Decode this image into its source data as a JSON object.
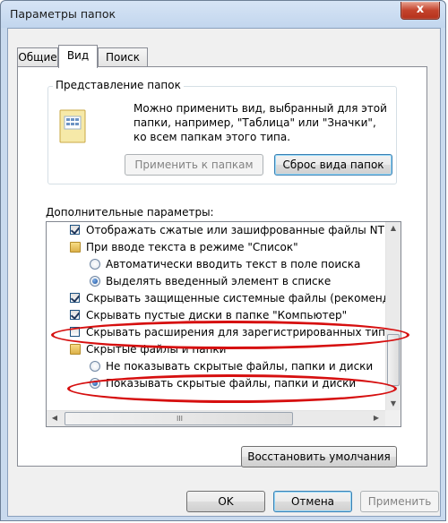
{
  "window": {
    "title": "Параметры папок",
    "close_glyph": "x"
  },
  "tabs": [
    {
      "label": "Общие",
      "active": false
    },
    {
      "label": "Вид",
      "active": true
    },
    {
      "label": "Поиск",
      "active": false
    }
  ],
  "folder_view": {
    "group_title": "Представление папок",
    "description_lines": [
      "Можно применить вид, выбранный для этой",
      "папки, например, \"Таблица\" или \"Значки\",",
      "ко всем папкам этого типа."
    ],
    "apply_button": "Применить к папкам",
    "apply_button_enabled": false,
    "reset_button": "Сброс вида папок"
  },
  "advanced": {
    "label": "Дополнительные параметры:",
    "items": [
      {
        "type": "checkbox",
        "checked": true,
        "text": "Отображать сжатые или зашифрованные файлы NTFS"
      },
      {
        "type": "folder",
        "text": "При вводе текста в режиме \"Список\""
      },
      {
        "type": "radio",
        "selected": false,
        "text": "Автоматически вводить текст в поле поиска"
      },
      {
        "type": "radio",
        "selected": true,
        "text": "Выделять введенный элемент в списке"
      },
      {
        "type": "checkbox",
        "checked": true,
        "text": "Скрывать защищенные системные файлы (рекомендуется)"
      },
      {
        "type": "checkbox",
        "checked": true,
        "text": "Скрывать пустые диски в папке \"Компьютер\""
      },
      {
        "type": "checkbox",
        "checked": false,
        "text": "Скрывать расширения для зарегистрированных типов файлов"
      },
      {
        "type": "folder",
        "text": "Скрытые файлы и папки"
      },
      {
        "type": "radio",
        "selected": false,
        "text": "Не показывать скрытые файлы, папки и диски"
      },
      {
        "type": "radio",
        "selected": true,
        "text": "Показывать скрытые файлы, папки и диски"
      }
    ],
    "scroll_left": "◀",
    "scroll_right": "▶",
    "scroll_up": "▲",
    "scroll_down": "▼",
    "h_grip": "III"
  },
  "restore_button": "Восстановить умолчания",
  "dialog_buttons": {
    "ok": "OK",
    "cancel": "Отмена",
    "apply": "Применить",
    "apply_enabled": false
  },
  "colors": {
    "annotation": "#d60f0f",
    "title_bar": "#c9daee",
    "close_button": "#c4432c"
  }
}
